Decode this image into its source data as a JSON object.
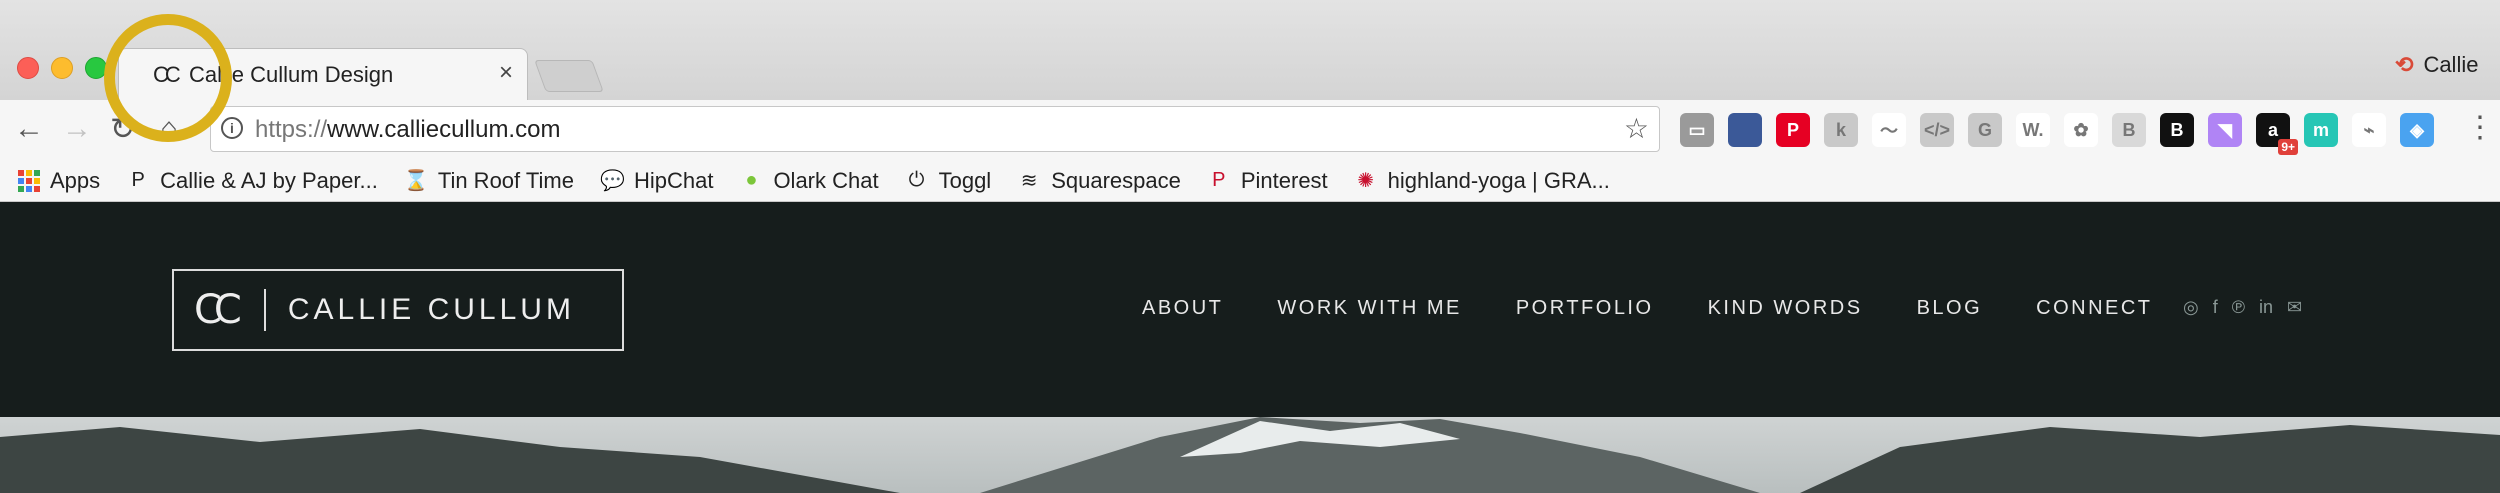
{
  "browser": {
    "tab": {
      "favicon": "CC",
      "title": "Callie Cullum Design",
      "close": "×"
    },
    "profile": {
      "icon": "profile-icon",
      "name": "Callie"
    },
    "url": {
      "scheme": "https://",
      "host": "www.calliecullum.com"
    },
    "nav": {
      "back": "←",
      "forward": "→",
      "reload": "↻",
      "home": "⌂"
    },
    "star": "☆",
    "menu": "⋮",
    "extensions": [
      {
        "name": "cast-icon",
        "label": "▭",
        "color": "#9a9a9a"
      },
      {
        "name": "us-flag-extension-icon",
        "label": "",
        "color": "#3b5998"
      },
      {
        "name": "pinterest-extension-icon",
        "label": "P",
        "color": "#e60023"
      },
      {
        "name": "grayscale-extension-icon",
        "label": "k",
        "color": "#c9c9c9"
      },
      {
        "name": "rainbow-extension-icon",
        "label": "〜",
        "color": "#ffffff"
      },
      {
        "name": "code-extension-icon",
        "label": "</>",
        "color": "#c9c9c9"
      },
      {
        "name": "grammarly-extension-icon",
        "label": "G",
        "color": "#c9c9c9"
      },
      {
        "name": "whatfont-extension-icon",
        "label": "W.",
        "color": "#ffffff"
      },
      {
        "name": "colorpick-extension-icon",
        "label": "✿",
        "color": "#ffffff"
      },
      {
        "name": "page-extension-icon",
        "label": "B",
        "color": "#d9d9d9"
      },
      {
        "name": "bold-extension-icon",
        "label": "B",
        "color": "#111111"
      },
      {
        "name": "purple-extension-icon",
        "label": "◥",
        "color": "#b084f5"
      },
      {
        "name": "amazon-extension-icon",
        "label": "a",
        "color": "#111111",
        "badge": "9+"
      },
      {
        "name": "teal-extension-icon",
        "label": "m",
        "color": "#26c6b5"
      },
      {
        "name": "wave-extension-icon",
        "label": "⌁",
        "color": "#ffffff"
      },
      {
        "name": "blue-diamond-extension-icon",
        "label": "◈",
        "color": "#4aa3f0"
      }
    ]
  },
  "bookmarks": [
    {
      "name": "bookmark-apps",
      "icon": "apps-grid-icon",
      "label": "Apps"
    },
    {
      "name": "bookmark-paper",
      "icon": "P",
      "label": "Callie & AJ by Paper..."
    },
    {
      "name": "bookmark-tin-roof",
      "icon": "⌛",
      "label": "Tin Roof Time"
    },
    {
      "name": "bookmark-hipchat",
      "icon": "💬",
      "label": "HipChat"
    },
    {
      "name": "bookmark-olark",
      "icon": "●",
      "label": "Olark Chat"
    },
    {
      "name": "bookmark-toggl",
      "icon": "⏻",
      "label": "Toggl"
    },
    {
      "name": "bookmark-squarespace",
      "icon": "≋",
      "label": "Squarespace"
    },
    {
      "name": "bookmark-pinterest",
      "icon": "P",
      "label": "Pinterest"
    },
    {
      "name": "bookmark-highland-yoga",
      "icon": "✺",
      "label": "highland-yoga | GRA..."
    }
  ],
  "site": {
    "logo": {
      "mark": "CC",
      "text": "CALLIE CULLUM"
    },
    "nav": [
      "ABOUT",
      "WORK WITH ME",
      "PORTFOLIO",
      "KIND WORDS",
      "BLOG",
      "CONNECT"
    ],
    "social": [
      {
        "name": "instagram-icon",
        "glyph": "◎"
      },
      {
        "name": "facebook-icon",
        "glyph": "f"
      },
      {
        "name": "pinterest-icon",
        "glyph": "℗"
      },
      {
        "name": "linkedin-icon",
        "glyph": "in"
      },
      {
        "name": "mail-icon",
        "glyph": "✉"
      }
    ]
  },
  "colors": {
    "header_bg": "#161d1c",
    "highlight_ring": "#dbb11c"
  }
}
